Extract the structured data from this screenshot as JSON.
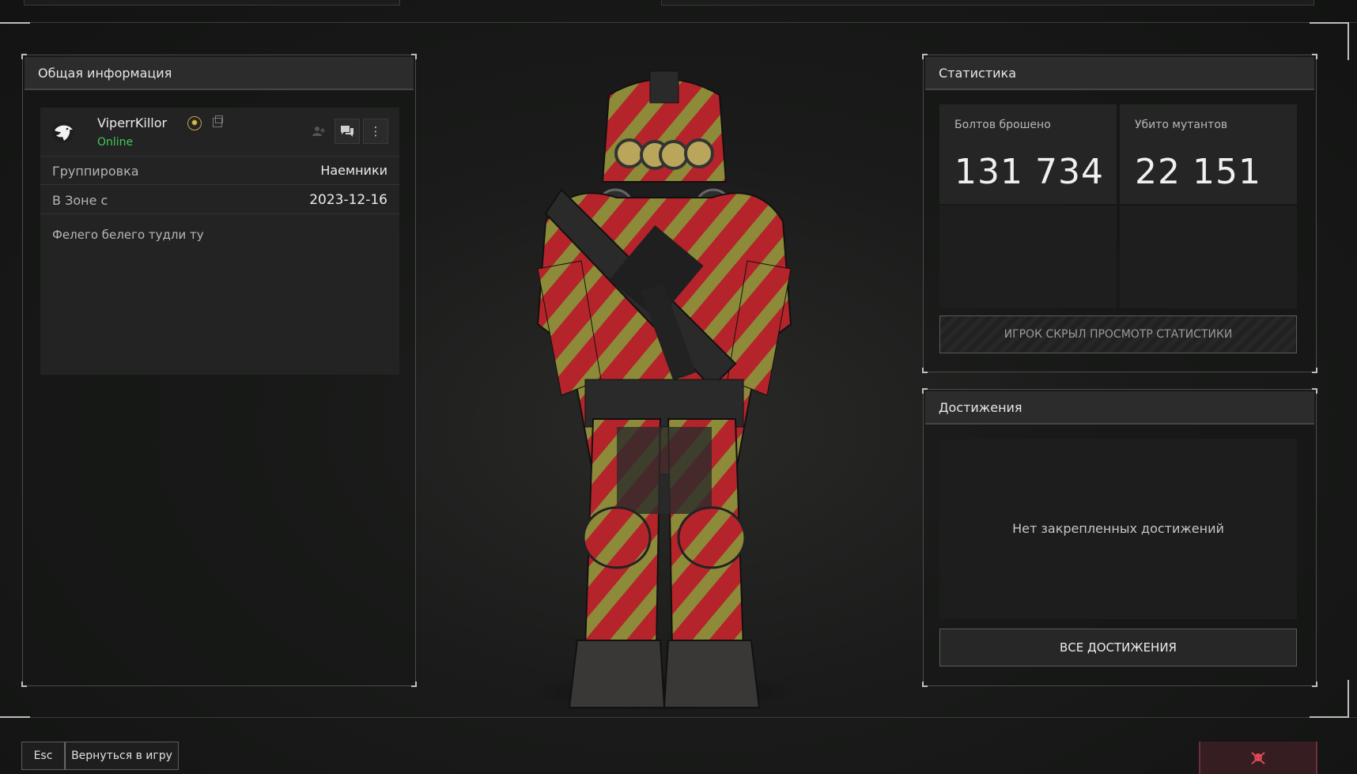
{
  "general": {
    "title": "Общая информация",
    "username": "ViperrKillor",
    "status": "Online",
    "badge_icon": "sun-badge-icon",
    "rows": [
      {
        "label": "Группировка",
        "value": "Наемники"
      },
      {
        "label": "В Зоне с",
        "value": "2023-12-16"
      }
    ],
    "bio": "Фелего белего тудли ту"
  },
  "stats": {
    "title": "Статистика",
    "items": [
      {
        "label": "Болтов брошено",
        "value": "131 734"
      },
      {
        "label": "Убито мутантов",
        "value": "22 151"
      }
    ],
    "hidden_notice": "ИГРОК СКРЫЛ ПРОСМОТР СТАТИСТИКИ"
  },
  "achievements": {
    "title": "Достижения",
    "empty_text": "Нет закрепленных достижений",
    "all_button": "ВСЕ ДОСТИЖЕНИЯ"
  },
  "footer": {
    "esc_label": "Esc",
    "back_label": "Вернуться в игру",
    "report_icon": "skull-crossbones-icon"
  },
  "colors": {
    "online": "#41c95a",
    "armor_red": "#b5242a",
    "armor_stripe": "#8d8a3a",
    "report_bg": "#351d22"
  }
}
